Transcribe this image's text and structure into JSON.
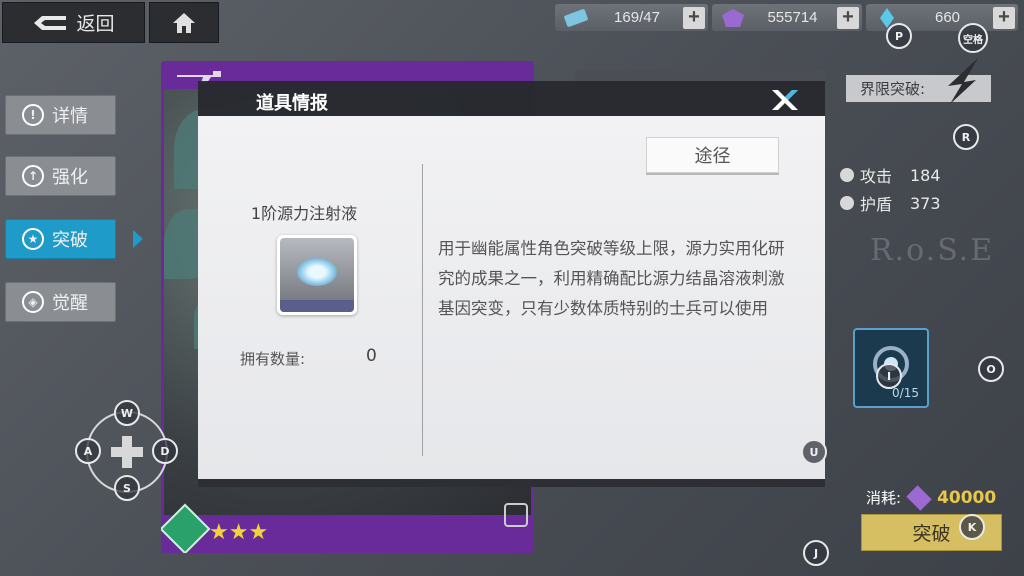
{
  "topbar": {
    "back_label": "返回",
    "resources": [
      {
        "icon": "stamina-ticket-icon",
        "value": "169/47"
      },
      {
        "icon": "purple-gem-icon",
        "value": "555714"
      },
      {
        "icon": "crystal-icon",
        "value": "660"
      }
    ]
  },
  "side_menu": [
    {
      "label": "详情",
      "icon": "exclamation-icon",
      "active": false
    },
    {
      "label": "强化",
      "icon": "upgrade-icon",
      "active": false
    },
    {
      "label": "突破",
      "icon": "star-icon",
      "active": true
    },
    {
      "label": "觉醒",
      "icon": "awaken-icon",
      "active": false
    }
  ],
  "card": {
    "stars": "★★★"
  },
  "right_panel": {
    "limit_break_label": "界限突破:",
    "stats": [
      {
        "label": "攻击",
        "value": "184"
      },
      {
        "label": "护盾",
        "value": "373"
      }
    ],
    "emblem_text": "R.o.S.E",
    "material_count": "0/15",
    "cost_label": "消耗:",
    "cost_value": "40000",
    "breakthrough_label": "突破"
  },
  "dialog": {
    "title": "道具情报",
    "path_label": "途径",
    "item_name": "1阶源力注射液",
    "own_label": "拥有数量:",
    "own_value": "0",
    "description": "用于幽能属性角色突破等级上限，源力实用化研究的成果之一，利用精确配比源力结晶溶液刺激基因突变，只有少数体质特别的士兵可以使用"
  },
  "keys": {
    "p": "P",
    "space": "空格",
    "r": "R",
    "i": "I",
    "o": "O",
    "u": "U",
    "k": "K",
    "j": "J",
    "w": "W",
    "a": "A",
    "s": "S",
    "d": "D"
  },
  "colors": {
    "active_tab": "#1e9bc8",
    "card_frame": "#6a2b9a",
    "breakthrough_button": "#d6bf63",
    "cost_number": "#e8c84a"
  }
}
